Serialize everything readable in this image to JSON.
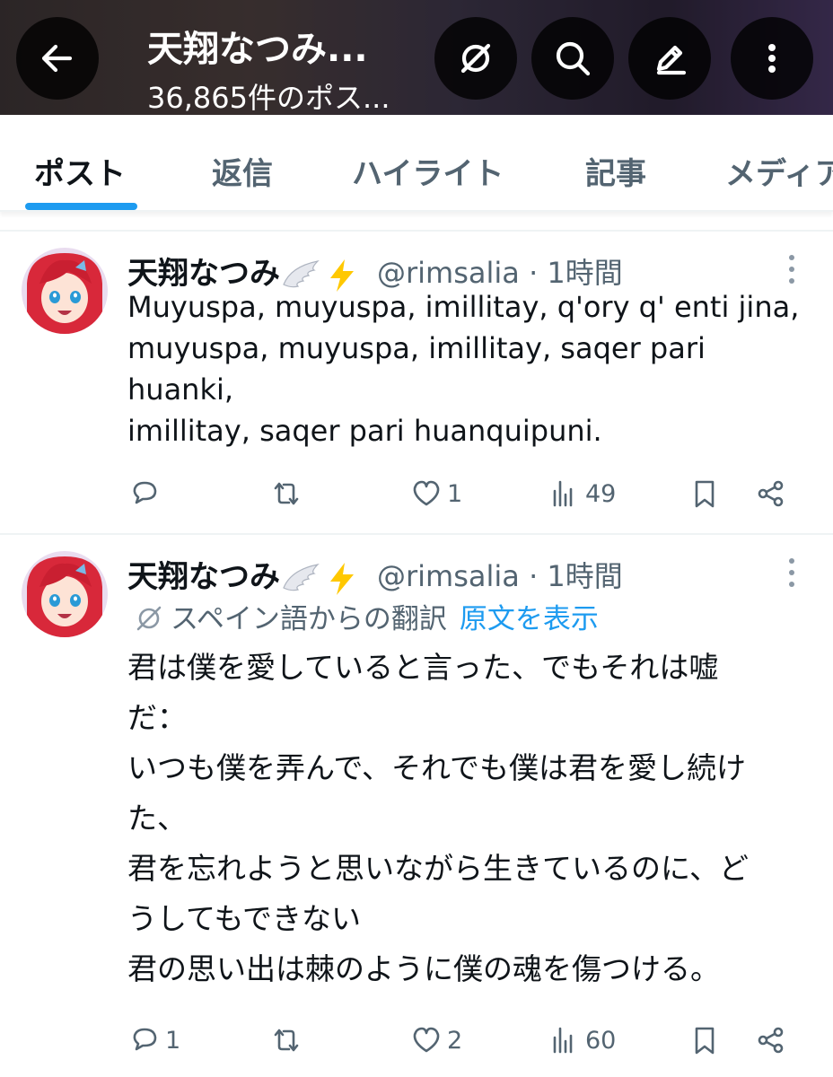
{
  "header": {
    "title": "天翔なつみ...",
    "post_count": "36,865件のポス...",
    "icons": [
      "back-arrow-icon",
      "grok-icon",
      "search-icon",
      "pen-icon",
      "more-vertical-icon"
    ]
  },
  "tabs": [
    {
      "label": "ポスト",
      "active": true
    },
    {
      "label": "返信",
      "active": false
    },
    {
      "label": "ハイライト",
      "active": false
    },
    {
      "label": "記事",
      "active": false
    },
    {
      "label": "メディア",
      "active": false
    }
  ],
  "posts": [
    {
      "name": "天翔なつみ",
      "handle_time": "@rimsalia · 1時間",
      "lines": [
        "Muyuspa, muyuspa, imillitay, q'ory q' enti jina,",
        "muyuspa, muyuspa, imillitay, saqer pari",
        "huanki,",
        "imillitay, saqer pari huanquipuni."
      ],
      "stats": {
        "replies": "",
        "reposts": "",
        "likes": "1",
        "views": "49"
      }
    },
    {
      "name": "天翔なつみ",
      "handle_time": "@rimsalia · 1時間",
      "translation_label": "スペイン語からの翻訳",
      "show_original": "原文を表示",
      "lines": [
        "君は僕を愛していると言った、でもそれは嘘",
        "だ：",
        "いつも僕を弄んで、それでも僕は君を愛し続け",
        "た、",
        "君を忘れようと思いながら生きているのに、ど",
        "うしてもできない",
        "君の思い出は棘のように僕の魂を傷つける。"
      ],
      "stats": {
        "replies": "1",
        "reposts": "",
        "likes": "2",
        "views": "60"
      }
    }
  ],
  "colors": {
    "accent": "#1d9bf0",
    "text": "#0f1419",
    "secondary": "#536471",
    "lightning": "#ffc800"
  }
}
